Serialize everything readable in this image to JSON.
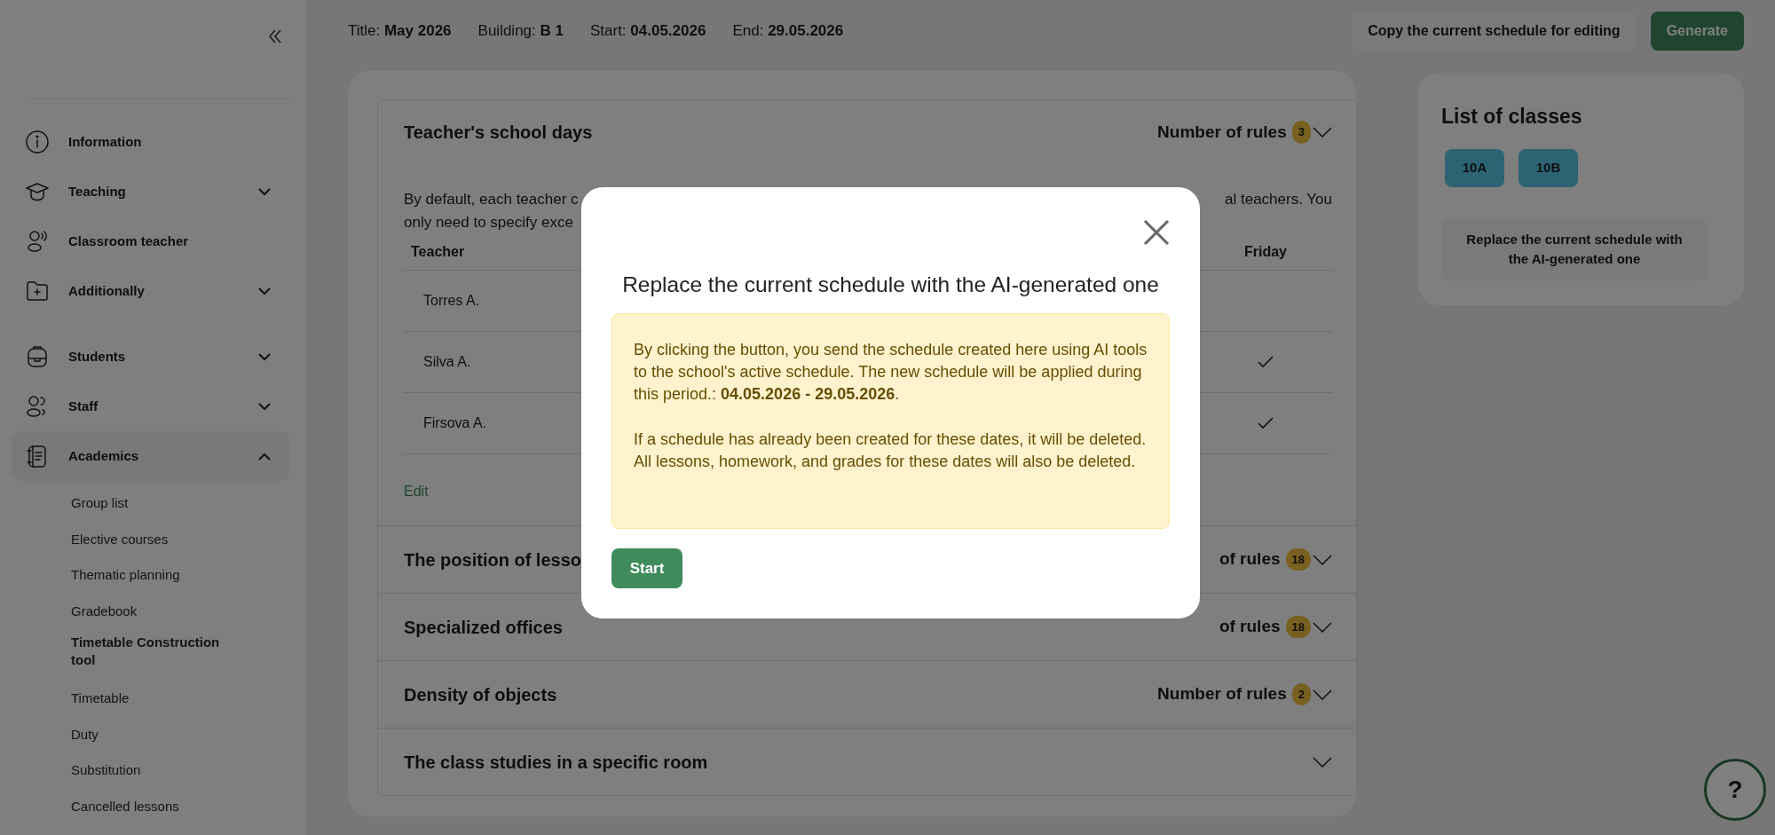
{
  "top_bar": {
    "fields": [
      {
        "label": "Title:",
        "value": "May 2026"
      },
      {
        "label": "Building:",
        "value": "B 1"
      },
      {
        "label": "Start:",
        "value": "04.05.2026"
      },
      {
        "label": "End:",
        "value": "29.05.2026"
      }
    ],
    "buttons": [
      {
        "label": "Copy the current schedule for editing",
        "kind": "secondary"
      },
      {
        "label": "Generate",
        "kind": "primary"
      }
    ]
  },
  "sidebar": {
    "groups": [
      {
        "items": [
          {
            "label": "Information",
            "kind": "link"
          },
          {
            "label": "Teaching",
            "kind": "menu",
            "expanded": false
          },
          {
            "label": "Classroom teacher",
            "kind": "link"
          },
          {
            "label": "Additionally",
            "kind": "menu",
            "expanded": false
          }
        ]
      },
      {
        "items": [
          {
            "label": "Students",
            "kind": "menu",
            "expanded": false
          },
          {
            "label": "Staff",
            "kind": "menu",
            "expanded": false
          },
          {
            "label": "Academics",
            "kind": "menu",
            "expanded": true,
            "children": [
              {
                "label": "Group list",
                "selected": false
              },
              {
                "label": "Elective courses",
                "selected": false
              },
              {
                "label": "Thematic planning",
                "selected": false
              },
              {
                "label": "Gradebook",
                "selected": false
              },
              {
                "label": "Timetable Construction tool",
                "selected": true
              },
              {
                "label": "Timetable",
                "selected": false
              },
              {
                "label": "Duty",
                "selected": false
              },
              {
                "label": "Substitution",
                "selected": false
              },
              {
                "label": "Cancelled lessons",
                "selected": false
              }
            ]
          }
        ]
      }
    ]
  },
  "sections": [
    {
      "title": "Teacher's school days",
      "rules_label": "Number of rules",
      "count": "3",
      "expanded": true,
      "body": {
        "description_left": [
          "By default, each teacher c",
          "only need to specify exce"
        ],
        "description_right": "al teachers. You",
        "columns": [
          "Teacher",
          "Friday"
        ],
        "rows": [
          {
            "teacher": "Torres A.",
            "friday_checked": false
          },
          {
            "teacher": "Silva A.",
            "friday_checked": true
          },
          {
            "teacher": "Firsova A.",
            "friday_checked": true
          }
        ],
        "edit_link": "Edit"
      }
    },
    {
      "title": "The position of lesso",
      "rules_label": "of rules",
      "count": "18",
      "expanded": false
    },
    {
      "title": "Specialized offices",
      "rules_label": "of rules",
      "count": "18",
      "expanded": false
    },
    {
      "title": "Density of objects",
      "rules_label": "Number of rules",
      "count": "2",
      "expanded": false
    },
    {
      "title": "The class studies in a specific room",
      "expanded": false
    }
  ],
  "right_panel": {
    "title": "List of classes",
    "classes": [
      {
        "label": "10A"
      },
      {
        "label": "10B"
      }
    ],
    "replace_button": "Replace the current schedule with the AI-generated one"
  },
  "help_button": "?",
  "modal": {
    "title": "Replace the current schedule with the AI-generated one",
    "paragraphs": [
      "By clicking the button, you send the schedule created here using AI tools to the school's active schedule. The new schedule will be applied during this period.: **04.05.2026 - 29.05.2026**.",
      "If a schedule has already been created for these dates, it will be deleted. All lessons, homework, and grades for these dates will also be deleted."
    ],
    "start_button": "Start"
  }
}
